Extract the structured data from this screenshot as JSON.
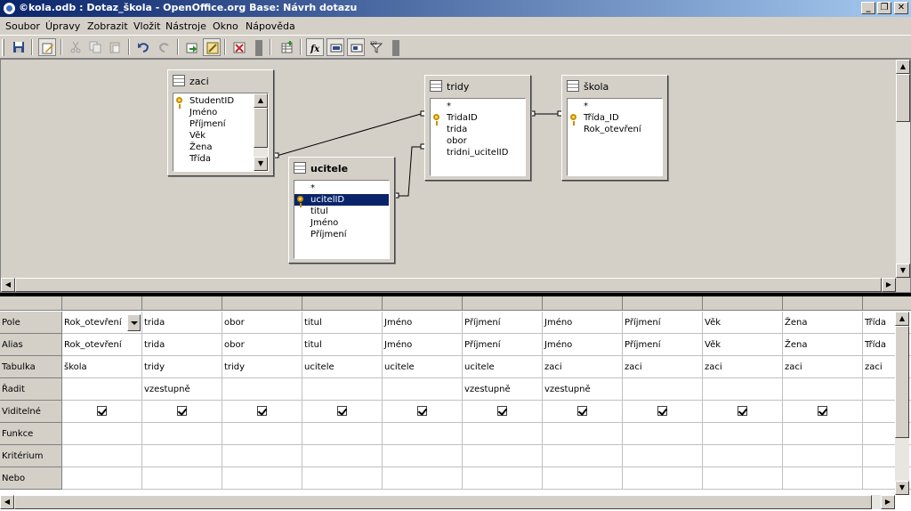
{
  "window": {
    "title": "©kola.odb : Dotaz_škola - OpenOffice.org Base: Návrh dotazu",
    "buttons": {
      "minimize": "_",
      "restore": "❐",
      "close": "✕"
    }
  },
  "menu": [
    "Soubor",
    "Úpravy",
    "Zobrazit",
    "Vložit",
    "Nástroje",
    "Okno",
    "Nápověda"
  ],
  "toolbar": {
    "icons": [
      "save-icon",
      "edit-icon",
      "cut-icon",
      "copy-icon",
      "paste-icon",
      "undo-icon",
      "redo-icon",
      "run-query-icon",
      "design-view-icon",
      "clear-query-icon",
      "add-table-icon",
      "functions-icon",
      "table-name-icon",
      "alias-icon",
      "distinct-values-icon"
    ],
    "functions_label": "fx"
  },
  "tables": {
    "zaci": {
      "name": "zaci",
      "fields": [
        "StudentID",
        "Jméno",
        "Příjmení",
        "Věk",
        "Žena",
        "Třída"
      ],
      "key_field": "StudentID"
    },
    "tridy": {
      "name": "tridy",
      "fields": [
        "*",
        "TridaID",
        "trida",
        "obor",
        "tridni_ucitelID"
      ],
      "key_field": "TridaID"
    },
    "skola": {
      "name": "škola",
      "fields": [
        "*",
        "Třída_ID",
        "Rok_otevření"
      ],
      "key_field": "Třída_ID"
    },
    "ucitele": {
      "name": "ucitele",
      "fields": [
        "*",
        "ucitelID",
        "titul",
        "Jméno",
        "Příjmení"
      ],
      "key_field": "ucitelID",
      "selected_field": "ucitelID"
    }
  },
  "grid": {
    "row_labels": [
      "Pole",
      "Alias",
      "Tabulka",
      "Řadit",
      "Viditelné",
      "Funkce",
      "Kritérium",
      "Nebo"
    ],
    "columns": [
      {
        "field": "Rok_otevření",
        "alias": "Rok_otevření",
        "table": "škola",
        "sort": "",
        "visible": true
      },
      {
        "field": "trida",
        "alias": "trida",
        "table": "tridy",
        "sort": "vzestupně",
        "visible": true
      },
      {
        "field": "obor",
        "alias": "obor",
        "table": "tridy",
        "sort": "",
        "visible": true
      },
      {
        "field": "titul",
        "alias": "titul",
        "table": "ucitele",
        "sort": "",
        "visible": true
      },
      {
        "field": "Jméno",
        "alias": "Jméno",
        "table": "ucitele",
        "sort": "",
        "visible": true
      },
      {
        "field": "Příjmení",
        "alias": "Příjmení",
        "table": "ucitele",
        "sort": "vzestupně",
        "visible": true
      },
      {
        "field": "Jméno",
        "alias": "Jméno",
        "table": "zaci",
        "sort": "vzestupně",
        "visible": true
      },
      {
        "field": "Příjmení",
        "alias": "Příjmení",
        "table": "zaci",
        "sort": "",
        "visible": true
      },
      {
        "field": "Věk",
        "alias": "Věk",
        "table": "zaci",
        "sort": "",
        "visible": true
      },
      {
        "field": "Žena",
        "alias": "Žena",
        "table": "zaci",
        "sort": "",
        "visible": true
      },
      {
        "field": "Třída",
        "alias": "Třída",
        "table": "zaci",
        "sort": "",
        "visible": false
      }
    ]
  }
}
